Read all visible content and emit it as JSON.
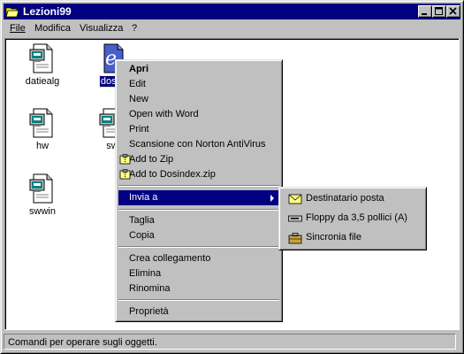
{
  "window": {
    "title": "Lezioni99",
    "folder_icon": "folder-open-icon",
    "controls": [
      "minimize-icon",
      "maximize-icon",
      "close-icon"
    ]
  },
  "menubar": {
    "file": "File",
    "modifica": "Modifica",
    "visualizza": "Visualizza",
    "help": "?"
  },
  "files": [
    {
      "label": "datiealg",
      "icon": "document-icon"
    },
    {
      "label": "dosin",
      "icon": "ie-document-icon",
      "selected": true
    },
    {
      "label": "hw",
      "icon": "document-icon"
    },
    {
      "label": "sw",
      "icon": "document-icon"
    },
    {
      "label": "swwin",
      "icon": "document-icon"
    }
  ],
  "context_menu": {
    "items": [
      {
        "label": "Apri",
        "bold": true
      },
      {
        "label": "Edit"
      },
      {
        "label": "New"
      },
      {
        "label": "Open with Word"
      },
      {
        "label": "Print"
      },
      {
        "label": "Scansione con Norton AntiVirus"
      },
      {
        "label": "Add to Zip",
        "icon": "winzip-icon"
      },
      {
        "label": "Add to Dosindex.zip",
        "icon": "winzip-icon"
      },
      {
        "label": "Invia a",
        "highlighted": true,
        "submenu": true
      },
      {
        "label": "Taglia"
      },
      {
        "label": "Copia"
      },
      {
        "label": "Crea collegamento"
      },
      {
        "label": "Elimina"
      },
      {
        "label": "Rinomina"
      },
      {
        "label": "Proprietà"
      }
    ]
  },
  "submenu": {
    "items": [
      {
        "label": "Destinatario posta",
        "icon": "envelope-icon"
      },
      {
        "label": "Floppy da 3,5 pollici (A)",
        "icon": "floppy-drive-icon"
      },
      {
        "label": "Sincronia file",
        "icon": "briefcase-icon"
      }
    ]
  },
  "status": {
    "text": "Comandi per operare sugli oggetti."
  },
  "colors": {
    "titlebar": "#000080",
    "face": "#c0c0c0",
    "highlight": "#000080"
  }
}
